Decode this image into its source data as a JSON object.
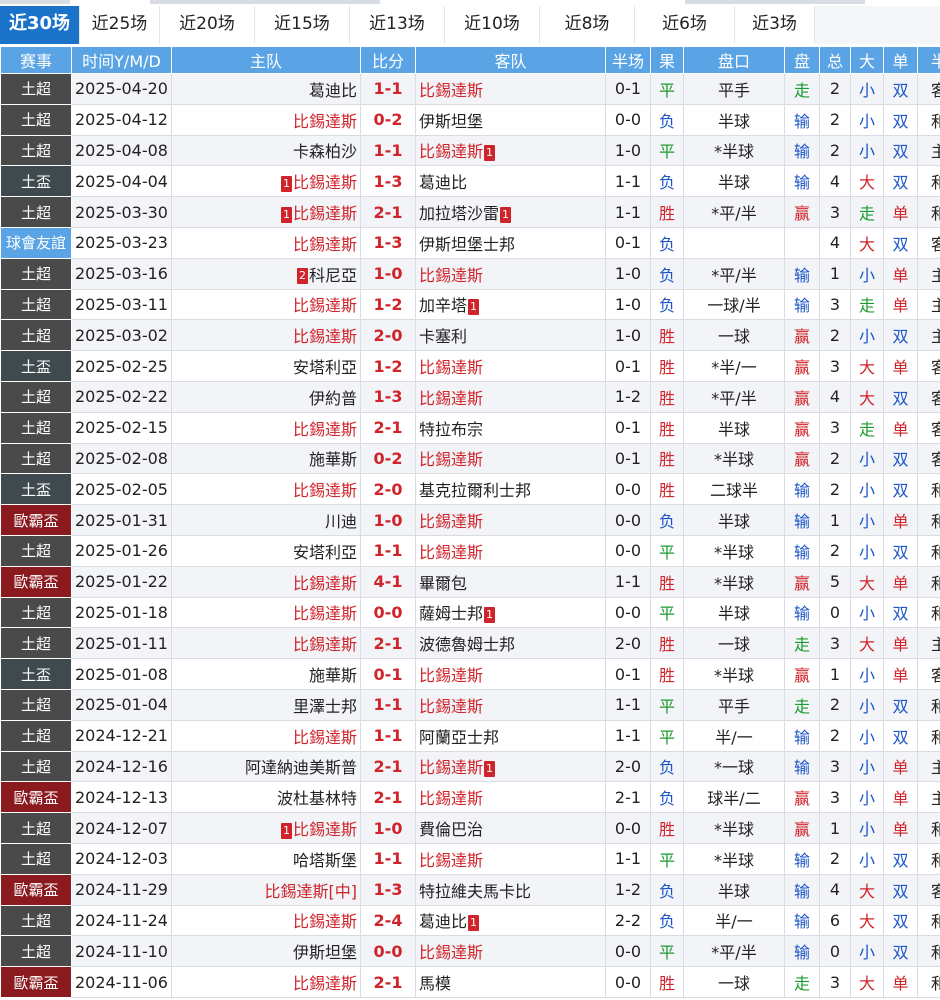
{
  "tabs": [
    "近30场",
    "近25场",
    "近20场",
    "近15场",
    "近13场",
    "近10场",
    "近8场",
    "近6场",
    "近3场"
  ],
  "active_tab": 0,
  "columns": [
    "赛事",
    "时间Y/M/D",
    "主队",
    "比分",
    "客队",
    "半场",
    "果",
    "盘口",
    "盘",
    "总",
    "大",
    "单",
    "半"
  ],
  "league_colors": {
    "土超": "#4a4a4a",
    "土盃": "#3f4a4f",
    "球會友誼": "#5aa4e6",
    "歐霸盃": "#8b1a1f"
  },
  "matches": [
    {
      "league": "土超",
      "date": "2025-04-20",
      "home": "葛迪比",
      "home_card": "",
      "home_hl": false,
      "score": "1-1",
      "away": "比錫達斯",
      "away_card": "",
      "away_hl": true,
      "half": "0-1",
      "result": "平",
      "handicap": "平手",
      "pan": "走",
      "total": "2",
      "size": "小",
      "oe": "双",
      "last": "客"
    },
    {
      "league": "土超",
      "date": "2025-04-12",
      "home": "比錫達斯",
      "home_card": "",
      "home_hl": true,
      "score": "0-2",
      "away": "伊斯坦堡",
      "away_card": "",
      "away_hl": false,
      "half": "0-0",
      "result": "负",
      "handicap": "半球",
      "pan": "输",
      "total": "2",
      "size": "小",
      "oe": "双",
      "last": "和"
    },
    {
      "league": "土超",
      "date": "2025-04-08",
      "home": "卡森柏沙",
      "home_card": "",
      "home_hl": false,
      "score": "1-1",
      "away": "比錫達斯",
      "away_card": "1",
      "away_hl": true,
      "half": "1-0",
      "result": "平",
      "handicap": "*半球",
      "pan": "输",
      "total": "2",
      "size": "小",
      "oe": "双",
      "last": "主"
    },
    {
      "league": "土盃",
      "date": "2025-04-04",
      "home": "比錫達斯",
      "home_card": "1",
      "home_hl": true,
      "score": "1-3",
      "away": "葛迪比",
      "away_card": "",
      "away_hl": false,
      "half": "1-1",
      "result": "负",
      "handicap": "半球",
      "pan": "输",
      "total": "4",
      "size": "大",
      "oe": "双",
      "last": "和"
    },
    {
      "league": "土超",
      "date": "2025-03-30",
      "home": "比錫達斯",
      "home_card": "1",
      "home_hl": true,
      "score": "2-1",
      "away": "加拉塔沙雷",
      "away_card": "1",
      "away_hl": false,
      "half": "1-1",
      "result": "胜",
      "handicap": "*平/半",
      "pan": "赢",
      "total": "3",
      "size": "走",
      "oe": "单",
      "last": "和"
    },
    {
      "league": "球會友誼",
      "date": "2025-03-23",
      "home": "比錫達斯",
      "home_card": "",
      "home_hl": true,
      "score": "1-3",
      "away": "伊斯坦堡士邦",
      "away_card": "",
      "away_hl": false,
      "half": "0-1",
      "result": "负",
      "handicap": "",
      "pan": "",
      "total": "4",
      "size": "大",
      "oe": "双",
      "last": "客"
    },
    {
      "league": "土超",
      "date": "2025-03-16",
      "home": "科尼亞",
      "home_card": "2",
      "home_hl": false,
      "score": "1-0",
      "away": "比錫達斯",
      "away_card": "",
      "away_hl": true,
      "half": "1-0",
      "result": "负",
      "handicap": "*平/半",
      "pan": "输",
      "total": "1",
      "size": "小",
      "oe": "单",
      "last": "主"
    },
    {
      "league": "土超",
      "date": "2025-03-11",
      "home": "比錫達斯",
      "home_card": "",
      "home_hl": true,
      "score": "1-2",
      "away": "加辛塔",
      "away_card": "1",
      "away_hl": false,
      "half": "1-0",
      "result": "负",
      "handicap": "一球/半",
      "pan": "输",
      "total": "3",
      "size": "走",
      "oe": "单",
      "last": "主"
    },
    {
      "league": "土超",
      "date": "2025-03-02",
      "home": "比錫達斯",
      "home_card": "",
      "home_hl": true,
      "score": "2-0",
      "away": "卡塞利",
      "away_card": "",
      "away_hl": false,
      "half": "1-0",
      "result": "胜",
      "handicap": "一球",
      "pan": "赢",
      "total": "2",
      "size": "小",
      "oe": "双",
      "last": "主"
    },
    {
      "league": "土盃",
      "date": "2025-02-25",
      "home": "安塔利亞",
      "home_card": "",
      "home_hl": false,
      "score": "1-2",
      "away": "比錫達斯",
      "away_card": "",
      "away_hl": true,
      "half": "0-1",
      "result": "胜",
      "handicap": "*半/一",
      "pan": "赢",
      "total": "3",
      "size": "大",
      "oe": "单",
      "last": "客"
    },
    {
      "league": "土超",
      "date": "2025-02-22",
      "home": "伊約普",
      "home_card": "",
      "home_hl": false,
      "score": "1-3",
      "away": "比錫達斯",
      "away_card": "",
      "away_hl": true,
      "half": "1-2",
      "result": "胜",
      "handicap": "*平/半",
      "pan": "赢",
      "total": "4",
      "size": "大",
      "oe": "双",
      "last": "客"
    },
    {
      "league": "土超",
      "date": "2025-02-15",
      "home": "比錫達斯",
      "home_card": "",
      "home_hl": true,
      "score": "2-1",
      "away": "特拉布宗",
      "away_card": "",
      "away_hl": false,
      "half": "0-1",
      "result": "胜",
      "handicap": "半球",
      "pan": "赢",
      "total": "3",
      "size": "走",
      "oe": "单",
      "last": "客"
    },
    {
      "league": "土超",
      "date": "2025-02-08",
      "home": "施華斯",
      "home_card": "",
      "home_hl": false,
      "score": "0-2",
      "away": "比錫達斯",
      "away_card": "",
      "away_hl": true,
      "half": "0-1",
      "result": "胜",
      "handicap": "*半球",
      "pan": "赢",
      "total": "2",
      "size": "小",
      "oe": "双",
      "last": "客"
    },
    {
      "league": "土盃",
      "date": "2025-02-05",
      "home": "比錫達斯",
      "home_card": "",
      "home_hl": true,
      "score": "2-0",
      "away": "基克拉爾利士邦",
      "away_card": "",
      "away_hl": false,
      "half": "0-0",
      "result": "胜",
      "handicap": "二球半",
      "pan": "输",
      "total": "2",
      "size": "小",
      "oe": "双",
      "last": "和"
    },
    {
      "league": "歐霸盃",
      "date": "2025-01-31",
      "home": "川迪",
      "home_card": "",
      "home_hl": false,
      "score": "1-0",
      "away": "比錫達斯",
      "away_card": "",
      "away_hl": true,
      "half": "0-0",
      "result": "负",
      "handicap": "半球",
      "pan": "输",
      "total": "1",
      "size": "小",
      "oe": "单",
      "last": "和"
    },
    {
      "league": "土超",
      "date": "2025-01-26",
      "home": "安塔利亞",
      "home_card": "",
      "home_hl": false,
      "score": "1-1",
      "away": "比錫達斯",
      "away_card": "",
      "away_hl": true,
      "half": "0-0",
      "result": "平",
      "handicap": "*半球",
      "pan": "输",
      "total": "2",
      "size": "小",
      "oe": "双",
      "last": "和"
    },
    {
      "league": "歐霸盃",
      "date": "2025-01-22",
      "home": "比錫達斯",
      "home_card": "",
      "home_hl": true,
      "score": "4-1",
      "away": "畢爾包",
      "away_card": "",
      "away_hl": false,
      "half": "1-1",
      "result": "胜",
      "handicap": "*半球",
      "pan": "赢",
      "total": "5",
      "size": "大",
      "oe": "单",
      "last": "和"
    },
    {
      "league": "土超",
      "date": "2025-01-18",
      "home": "比錫達斯",
      "home_card": "",
      "home_hl": true,
      "score": "0-0",
      "away": "薩姆士邦",
      "away_card": "1",
      "away_hl": false,
      "half": "0-0",
      "result": "平",
      "handicap": "半球",
      "pan": "输",
      "total": "0",
      "size": "小",
      "oe": "双",
      "last": "和"
    },
    {
      "league": "土超",
      "date": "2025-01-11",
      "home": "比錫達斯",
      "home_card": "",
      "home_hl": true,
      "score": "2-1",
      "away": "波德魯姆士邦",
      "away_card": "",
      "away_hl": false,
      "half": "2-0",
      "result": "胜",
      "handicap": "一球",
      "pan": "走",
      "total": "3",
      "size": "大",
      "oe": "单",
      "last": "主"
    },
    {
      "league": "土盃",
      "date": "2025-01-08",
      "home": "施華斯",
      "home_card": "",
      "home_hl": false,
      "score": "0-1",
      "away": "比錫達斯",
      "away_card": "",
      "away_hl": true,
      "half": "0-1",
      "result": "胜",
      "handicap": "*半球",
      "pan": "赢",
      "total": "1",
      "size": "小",
      "oe": "单",
      "last": "客"
    },
    {
      "league": "土超",
      "date": "2025-01-04",
      "home": "里澤士邦",
      "home_card": "",
      "home_hl": false,
      "score": "1-1",
      "away": "比錫達斯",
      "away_card": "",
      "away_hl": true,
      "half": "1-1",
      "result": "平",
      "handicap": "平手",
      "pan": "走",
      "total": "2",
      "size": "小",
      "oe": "双",
      "last": "和"
    },
    {
      "league": "土超",
      "date": "2024-12-21",
      "home": "比錫達斯",
      "home_card": "",
      "home_hl": true,
      "score": "1-1",
      "away": "阿蘭亞士邦",
      "away_card": "",
      "away_hl": false,
      "half": "1-1",
      "result": "平",
      "handicap": "半/一",
      "pan": "输",
      "total": "2",
      "size": "小",
      "oe": "双",
      "last": "和"
    },
    {
      "league": "土超",
      "date": "2024-12-16",
      "home": "阿達納迪美斯普",
      "home_card": "",
      "home_hl": false,
      "score": "2-1",
      "away": "比錫達斯",
      "away_card": "1",
      "away_hl": true,
      "half": "2-0",
      "result": "负",
      "handicap": "*一球",
      "pan": "输",
      "total": "3",
      "size": "小",
      "oe": "单",
      "last": "主"
    },
    {
      "league": "歐霸盃",
      "date": "2024-12-13",
      "home": "波杜基林特",
      "home_card": "",
      "home_hl": false,
      "score": "2-1",
      "away": "比錫達斯",
      "away_card": "",
      "away_hl": true,
      "half": "2-1",
      "result": "负",
      "handicap": "球半/二",
      "pan": "赢",
      "total": "3",
      "size": "小",
      "oe": "单",
      "last": "主"
    },
    {
      "league": "土超",
      "date": "2024-12-07",
      "home": "比錫達斯",
      "home_card": "1",
      "home_hl": true,
      "score": "1-0",
      "away": "費倫巴治",
      "away_card": "",
      "away_hl": false,
      "half": "0-0",
      "result": "胜",
      "handicap": "*半球",
      "pan": "赢",
      "total": "1",
      "size": "小",
      "oe": "单",
      "last": "和"
    },
    {
      "league": "土超",
      "date": "2024-12-03",
      "home": "哈塔斯堡",
      "home_card": "",
      "home_hl": false,
      "score": "1-1",
      "away": "比錫達斯",
      "away_card": "",
      "away_hl": true,
      "half": "1-1",
      "result": "平",
      "handicap": "*半球",
      "pan": "输",
      "total": "2",
      "size": "小",
      "oe": "双",
      "last": "和"
    },
    {
      "league": "歐霸盃",
      "date": "2024-11-29",
      "home": "比錫達斯[中]",
      "home_card": "",
      "home_hl": true,
      "score": "1-3",
      "away": "特拉維夫馬卡比",
      "away_card": "",
      "away_hl": false,
      "half": "1-2",
      "result": "负",
      "handicap": "半球",
      "pan": "输",
      "total": "4",
      "size": "大",
      "oe": "双",
      "last": "客"
    },
    {
      "league": "土超",
      "date": "2024-11-24",
      "home": "比錫達斯",
      "home_card": "",
      "home_hl": true,
      "score": "2-4",
      "away": "葛迪比",
      "away_card": "1",
      "away_hl": false,
      "half": "2-2",
      "result": "负",
      "handicap": "半/一",
      "pan": "输",
      "total": "6",
      "size": "大",
      "oe": "双",
      "last": "和"
    },
    {
      "league": "土超",
      "date": "2024-11-10",
      "home": "伊斯坦堡",
      "home_card": "",
      "home_hl": false,
      "score": "0-0",
      "away": "比錫達斯",
      "away_card": "",
      "away_hl": true,
      "half": "0-0",
      "result": "平",
      "handicap": "*平/半",
      "pan": "输",
      "total": "0",
      "size": "小",
      "oe": "双",
      "last": "和"
    },
    {
      "league": "歐霸盃",
      "date": "2024-11-06",
      "home": "比錫達斯",
      "home_card": "",
      "home_hl": true,
      "score": "2-1",
      "away": "馬模",
      "away_card": "",
      "away_hl": false,
      "half": "0-0",
      "result": "胜",
      "handicap": "一球",
      "pan": "走",
      "total": "3",
      "size": "大",
      "oe": "单",
      "last": "和"
    }
  ]
}
